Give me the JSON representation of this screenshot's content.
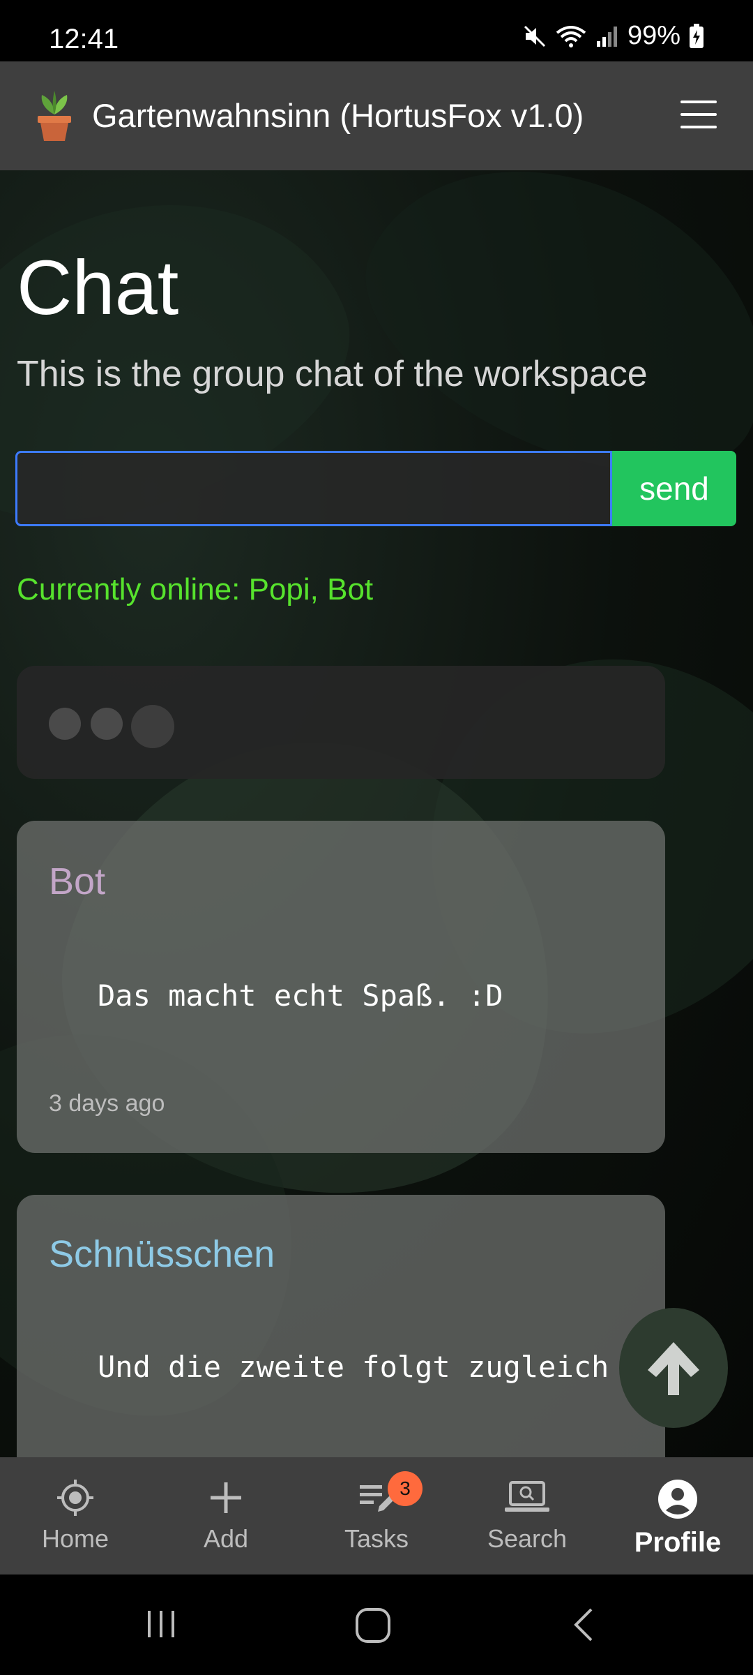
{
  "status": {
    "time": "12:41",
    "battery": "99%"
  },
  "app": {
    "title": "Gartenwahnsinn (HortusFox v1.0)"
  },
  "page": {
    "title": "Chat",
    "subtitle": "This is the group chat of the workspace"
  },
  "chat": {
    "input_value": "",
    "send_label": "send",
    "online": "Currently online: Popi, Bot",
    "messages": [
      {
        "author": "Bot",
        "author_color": "#c3a6c8",
        "text": "Das macht echt Spaß. :D",
        "time": "3 days ago"
      },
      {
        "author": "Schnüsschen",
        "author_color": "#8ecae6",
        "text": "Und die zweite folgt zugleich"
      }
    ]
  },
  "nav": {
    "items": [
      {
        "label": "Home",
        "icon": "crosshair-icon"
      },
      {
        "label": "Add",
        "icon": "plus-icon"
      },
      {
        "label": "Tasks",
        "icon": "tasks-edit-icon",
        "badge": "3"
      },
      {
        "label": "Search",
        "icon": "laptop-search-icon"
      },
      {
        "label": "Profile",
        "icon": "user-circle-icon",
        "active": true
      }
    ]
  },
  "colors": {
    "accent_send": "#22c55e",
    "online_text": "#57e32d",
    "badge": "#ff6a3d",
    "input_border": "#3d7bff"
  }
}
